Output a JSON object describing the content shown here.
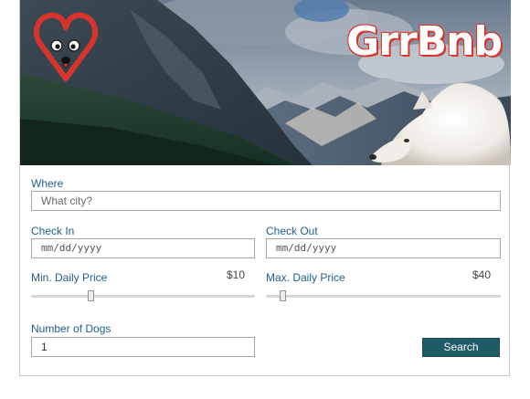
{
  "brand": {
    "name": "GrrBnb"
  },
  "form": {
    "where_label": "Where",
    "where_placeholder": "What city?",
    "check_in_label": "Check In",
    "check_in_value": "mm/dd/yyyy",
    "check_out_label": "Check Out",
    "check_out_value": "mm/dd/yyyy",
    "min_price_label": "Min. Daily Price",
    "min_price_value": "$10",
    "min_price_fraction": 0.26,
    "max_price_label": "Max. Daily Price",
    "max_price_value": "$40",
    "max_price_fraction": 0.06,
    "dogs_label": "Number of Dogs",
    "dogs_value": "1",
    "search_label": "Search"
  },
  "colors": {
    "label": "#1f5f8b",
    "button": "#1d5b67",
    "brand_outline": "#d9342b"
  }
}
